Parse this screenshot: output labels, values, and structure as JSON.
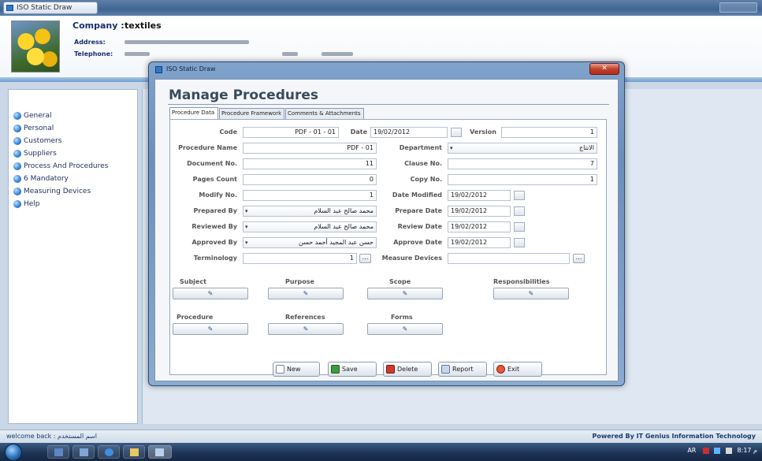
{
  "window": {
    "tab_title": "ISO Static Draw"
  },
  "company": {
    "label": "Company :",
    "name": "textiles",
    "address_label": "Address:",
    "telephone_label": "Telephone:"
  },
  "nav": {
    "items": [
      {
        "label": "General"
      },
      {
        "label": "Personal"
      },
      {
        "label": "Customers"
      },
      {
        "label": "Suppliers"
      },
      {
        "label": "Process And Procedures"
      },
      {
        "label": "6 Mandatory"
      },
      {
        "label": "Measuring Devices"
      },
      {
        "label": "Help"
      }
    ]
  },
  "status": {
    "left": "welcome back : اسم المستخدم",
    "right": "Powered By IT Genius Information Technology"
  },
  "taskbar": {
    "language": "AR",
    "time": "8:17 م"
  },
  "dialog": {
    "title": "ISO Static Draw",
    "close_label": "✕",
    "form_title": "Manage Procedures",
    "tabs": [
      {
        "label": "Procedure Data"
      },
      {
        "label": "Procedure Framework"
      },
      {
        "label": "Comments & Attachments"
      }
    ],
    "fields": {
      "code": {
        "label": "Code",
        "value": "PDF - 01 - 01"
      },
      "date": {
        "label": "Date",
        "value": "19/02/2012"
      },
      "version": {
        "label": "Version",
        "value": "1"
      },
      "procedure_name": {
        "label": "Procedure Name",
        "value": "PDF - 01"
      },
      "department": {
        "label": "Department",
        "value": "الانتاج"
      },
      "document_no": {
        "label": "Document No.",
        "value": "11"
      },
      "clause_no": {
        "label": "Clause No.",
        "value": "7"
      },
      "pages_count": {
        "label": "Pages Count",
        "value": "0"
      },
      "copy_no": {
        "label": "Copy No.",
        "value": "1"
      },
      "modify_no": {
        "label": "Modify No.",
        "value": "1"
      },
      "date_modified": {
        "label": "Date Modified",
        "value": "19/02/2012"
      },
      "prepared_by": {
        "label": "Prepared By",
        "value": "محمد صالح عبد السلام"
      },
      "prepare_date": {
        "label": "Prepare Date",
        "value": "19/02/2012"
      },
      "reviewed_by": {
        "label": "Reviewed By",
        "value": "محمد صالح عبد السلام"
      },
      "review_date": {
        "label": "Review Date",
        "value": "19/02/2012"
      },
      "approved_by": {
        "label": "Approved By",
        "value": "حسن عبد المجيد أحمد حسن"
      },
      "approve_date": {
        "label": "Approve Date",
        "value": "19/02/2012"
      },
      "terminology": {
        "label": "Terminology",
        "value": "1"
      },
      "measure_devices": {
        "label": "Measure Devices",
        "value": ""
      }
    },
    "sections": {
      "subject": "Subject",
      "purpose": "Purpose",
      "scope": "Scope",
      "responsibilities": "Responsibilities",
      "procedure": "Procedure",
      "references": "References",
      "forms": "Forms"
    },
    "actions": {
      "new": "New",
      "save": "Save",
      "delete": "Delete",
      "report": "Report",
      "exit": "Exit"
    }
  }
}
